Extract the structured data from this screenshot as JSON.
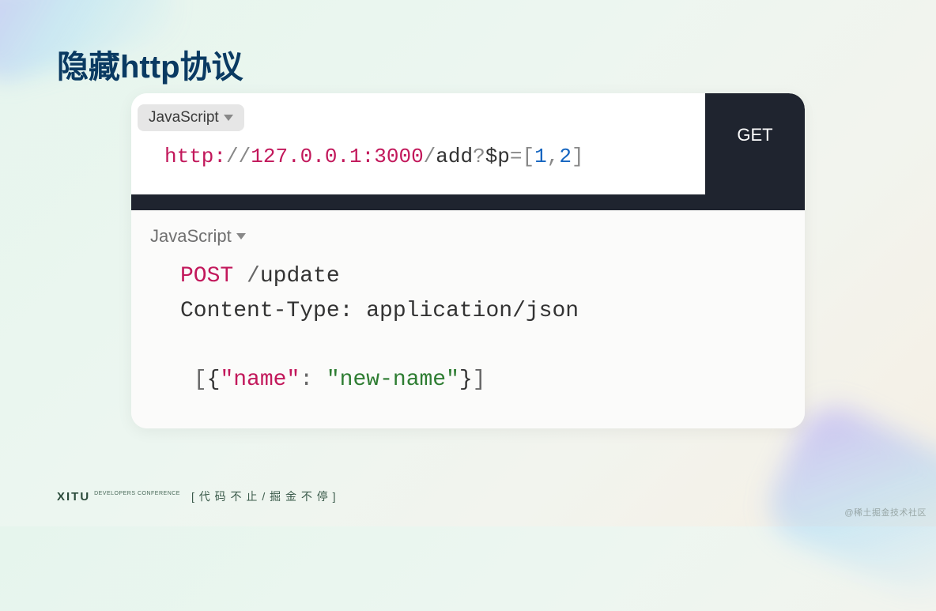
{
  "title": "隐藏http协议",
  "block1": {
    "lang": "JavaScript",
    "method": "GET",
    "code": {
      "scheme": "http:",
      "slashes": "//",
      "host": "127.0.0.1:3000",
      "slash": "/",
      "path": "add",
      "q": "?",
      "param": "$p",
      "eq": "=",
      "lb": "[",
      "v1": "1",
      "comma": ",",
      "v2": "2",
      "rb": "]"
    }
  },
  "block2": {
    "lang": "JavaScript",
    "line1": {
      "method": "POST",
      "space": " ",
      "slash": "/",
      "path": "update"
    },
    "line2": {
      "header": "Content-Type:",
      "space": " ",
      "value": "application/json"
    },
    "line3": {
      "pre": " ",
      "lb": "[",
      "lbr": "{",
      "k": "\"name\"",
      "colon": ": ",
      "v": "\"new-name\"",
      "rbr": "}",
      "rb": "]"
    }
  },
  "footer": {
    "logo": "XITU",
    "logo_sub": "DEVELOPERS CONFERENCE",
    "slogan": "[ 代 码 不 止 / 掘 金 不 停 ]"
  },
  "watermark": "@稀土掘金技术社区"
}
